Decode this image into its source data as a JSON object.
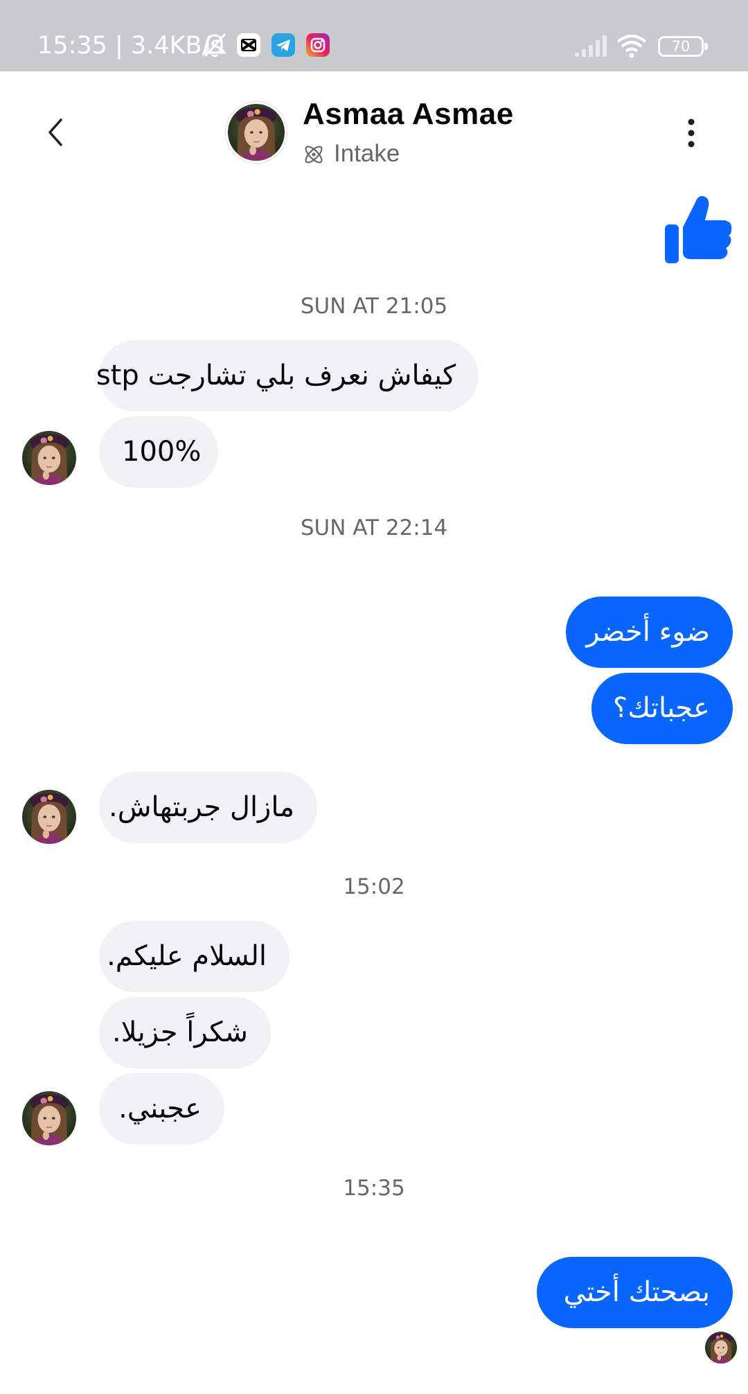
{
  "status_bar": {
    "time": "15:35 | 3.4KB/s",
    "battery": "70",
    "icons": [
      "bell-muted-icon",
      "capcut-icon",
      "telegram-icon",
      "instagram-icon",
      "signal-icon",
      "wifi-icon",
      "battery-icon"
    ]
  },
  "header": {
    "name": "Asmaa Asmae",
    "subtitle": "Intake",
    "subtitle_icon": "atom-icon",
    "back_icon": "chevron-left-icon",
    "menu_icon": "more-vertical-icon"
  },
  "colors": {
    "accent": "#0866ff",
    "incoming_bubble": "#f0f2f5",
    "status_bar": "#c8cacd"
  },
  "reaction": {
    "icon": "thumbs-up-icon"
  },
  "timestamps": [
    "SUN AT 21:05",
    "SUN AT 22:14",
    "15:02",
    "15:35"
  ],
  "messages": [
    {
      "sender": "contact",
      "text": "كيفاش نعرف بلي تشارجت stp"
    },
    {
      "sender": "contact",
      "text": "100%"
    },
    {
      "sender": "me",
      "text": "ضوء أخضر"
    },
    {
      "sender": "me",
      "text": "عجباتك؟"
    },
    {
      "sender": "contact",
      "text": "مازال جربتهاش."
    },
    {
      "sender": "contact",
      "text": "السلام عليكم."
    },
    {
      "sender": "contact",
      "text": "شكراً جزيلا."
    },
    {
      "sender": "contact",
      "text": "عجبني."
    },
    {
      "sender": "me",
      "text": "بصحتك أختي"
    }
  ]
}
